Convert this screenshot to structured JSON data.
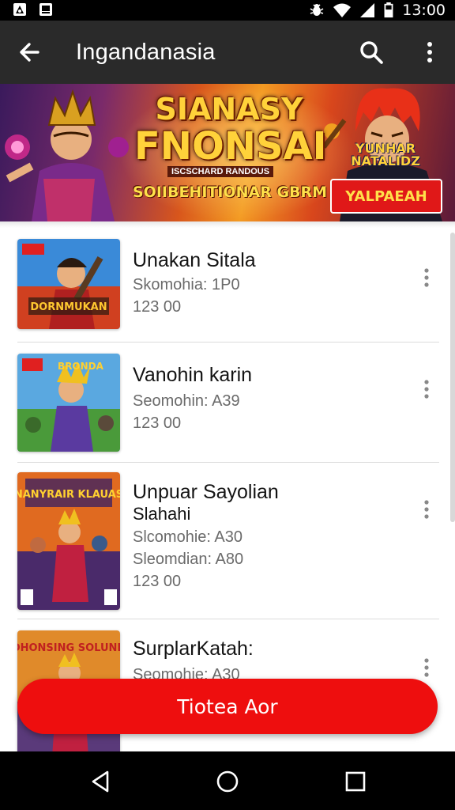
{
  "status_bar": {
    "time": "13:00",
    "left_icons": [
      "app-notification-icon",
      "gallery-icon"
    ],
    "right_icons": [
      "bug-icon",
      "wifi-icon",
      "signal-icon",
      "battery-icon"
    ]
  },
  "app_bar": {
    "title": "Ingandanasia",
    "icons": [
      "back-arrow-icon",
      "search-icon",
      "more-vert-icon"
    ]
  },
  "banner": {
    "title_line1": "SIANASY",
    "title_line2": "FNONSAI",
    "small_label": "ISCSCHARD RANDOUS",
    "subtitle": "SOIIBEHITIONAR GBRM",
    "right_title": "YUNHAR NATALIDZ",
    "badge": "YALPAEAH"
  },
  "items": [
    {
      "title": "Unakan Sitala",
      "lines": [
        "Skomohia: 1P0",
        "123 00"
      ],
      "thumb_label": "DORNMUKAN",
      "thumb_colors": [
        "#3a8ad8",
        "#d04020"
      ]
    },
    {
      "title": "Vanohin karin",
      "lines": [
        "Seomohin: A39",
        "123 00"
      ],
      "thumb_label": "BRONDA",
      "thumb_colors": [
        "#5aa8e0",
        "#4a9a3a"
      ]
    },
    {
      "title": "Unpuar Sayolian",
      "title2": "Slahahi",
      "lines": [
        "Slcomohie: A30",
        "Sleomdian: A80",
        "123 00"
      ],
      "thumb_label": "NANYRAIR KLAUAS",
      "thumb_colors": [
        "#e06a20",
        "#4a2a6a"
      ]
    },
    {
      "title": "SurplarKatah:",
      "lines": [
        "Seomohie: A30"
      ],
      "thumb_label": "DHONSING SOLUND",
      "thumb_colors": [
        "#e08a2a",
        "#5a3a7a"
      ]
    }
  ],
  "fab": {
    "label": "Tiotea Aor"
  },
  "nav_bar": {
    "icons": [
      "nav-back-icon",
      "nav-home-icon",
      "nav-recents-icon"
    ]
  }
}
